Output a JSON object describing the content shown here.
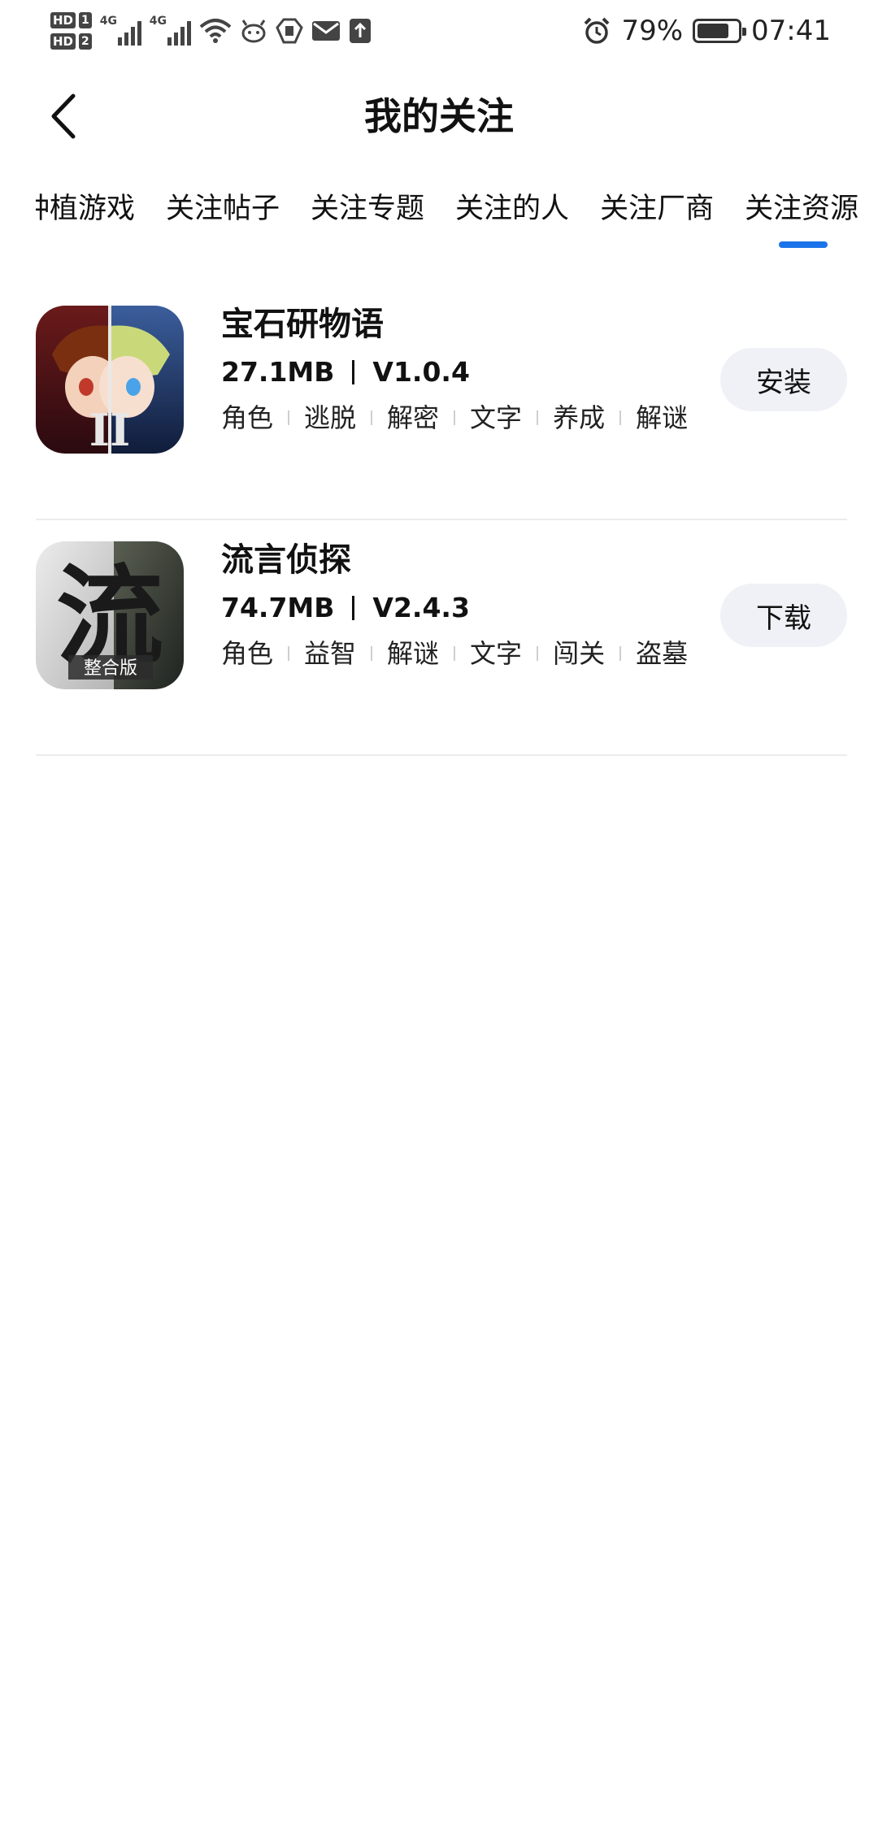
{
  "status_bar": {
    "hd1": "HD",
    "hd1_num": "1",
    "hd2": "HD",
    "hd2_num": "2",
    "net1": "4G",
    "net2": "4G",
    "battery_percent": "79%",
    "battery_level": 0.79,
    "time": "07:41",
    "icons": [
      "signal-icon",
      "wifi-icon",
      "app-notification-icon",
      "shield-icon",
      "mail-icon",
      "upload-icon",
      "alarm-icon",
      "battery-icon"
    ]
  },
  "header": {
    "title": "我的关注"
  },
  "tabs": [
    {
      "label": "种植游戏"
    },
    {
      "label": "关注帖子"
    },
    {
      "label": "关注专题"
    },
    {
      "label": "关注的人"
    },
    {
      "label": "关注厂商"
    },
    {
      "label": "关注资源"
    }
  ],
  "active_tab": 5,
  "items": [
    {
      "name": "宝石研物语",
      "size": "27.1MB",
      "version": "V1.0.4",
      "tags": [
        "角色",
        "逃脱",
        "解密",
        "文字",
        "养成",
        "解谜"
      ],
      "button": "安装",
      "icon": "gem-story-game-icon"
    },
    {
      "name": "流言侦探",
      "size": "74.7MB",
      "version": "V2.4.3",
      "tags": [
        "角色",
        "益智",
        "解谜",
        "文字",
        "闯关",
        "盗墓"
      ],
      "button": "下载",
      "icon": "rumor-detective-game-icon",
      "icon_text": "流",
      "icon_subtext": "整合版"
    }
  ],
  "colors": {
    "accent": "#1a73e8",
    "button_bg": "#eff1f6",
    "divider": "#ececec"
  }
}
